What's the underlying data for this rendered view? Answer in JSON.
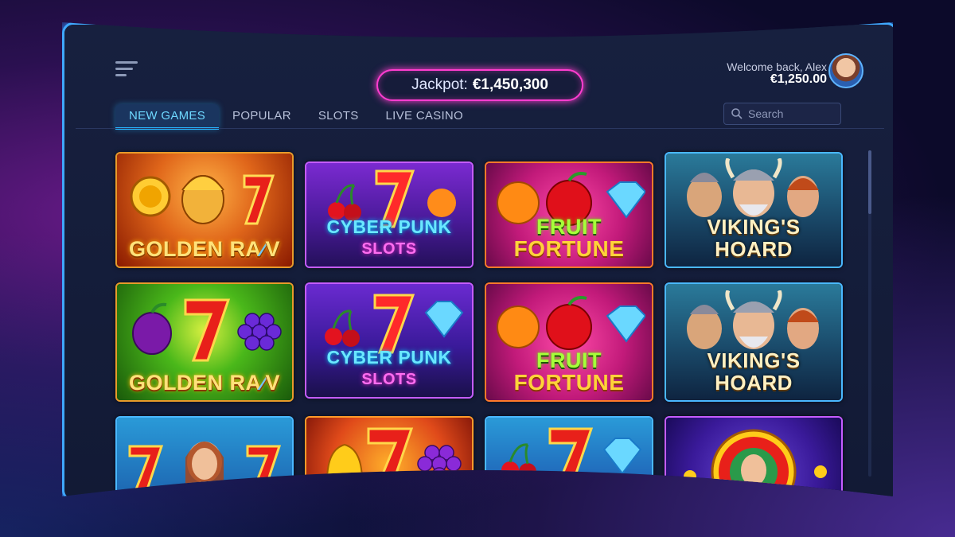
{
  "header": {
    "jackpot_label": "Jackpot:",
    "jackpot_value": "€1,450,300",
    "welcome_text": "Welcome back, Alex",
    "balance": "€1,250.00"
  },
  "tabs": [
    {
      "label": "NEW GAMES",
      "active": true
    },
    {
      "label": "POPULAR",
      "active": false
    },
    {
      "label": "SLOTS",
      "active": false
    },
    {
      "label": "LIVE CASINO",
      "active": false
    }
  ],
  "search": {
    "placeholder": "Search"
  },
  "games": [
    {
      "title": "GOLDEN RA",
      "title2": "V",
      "style": "golden"
    },
    {
      "title": "CYBER PUNK",
      "subtitle": "SLOTS",
      "style": "cyber"
    },
    {
      "title": "FRUIT",
      "subtitle": "FORTUNE",
      "style": "fruit"
    },
    {
      "title": "VIKING'S",
      "subtitle": "HOARD",
      "style": "viking"
    },
    {
      "title": "GOLDEN RA",
      "title2": "V",
      "style": "golden"
    },
    {
      "title": "CYBER PUNK",
      "subtitle": "SLOTS",
      "style": "cyber"
    },
    {
      "title": "FRUIT",
      "subtitle": "FORTUNE",
      "style": "fruit"
    },
    {
      "title": "VIKING'S",
      "subtitle": "HOARD",
      "style": "viking"
    }
  ],
  "colors": {
    "accent_blue": "#3fa8ff",
    "jackpot_pink": "#ff3dd0",
    "tab_active": "#6ed8ff"
  }
}
